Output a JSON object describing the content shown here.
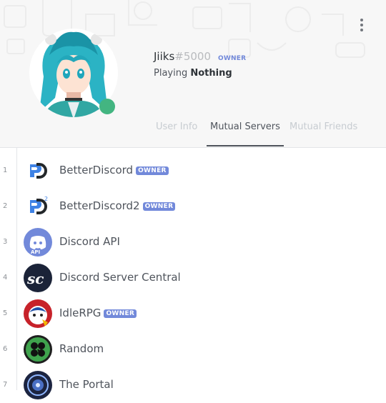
{
  "profile": {
    "username": "Jiiks",
    "discriminator": "#5000",
    "owner_tag": "OWNER",
    "activity_prefix": "Playing",
    "activity_name": "Nothing",
    "status": "online",
    "status_color": "#43b581"
  },
  "tabs": [
    {
      "label": "User Info",
      "active": false
    },
    {
      "label": "Mutual Servers",
      "active": true
    },
    {
      "label": "Mutual Friends",
      "active": false
    }
  ],
  "servers": [
    {
      "num": "1",
      "name": "BetterDiscord",
      "owner": true,
      "badge": "OWNER",
      "icon": "betterdiscord-icon"
    },
    {
      "num": "2",
      "name": "BetterDiscord2",
      "owner": true,
      "badge": "OWNER",
      "icon": "betterdiscord2-icon"
    },
    {
      "num": "3",
      "name": "Discord API",
      "owner": false,
      "badge": "",
      "icon": "discord-api-icon"
    },
    {
      "num": "4",
      "name": "Discord Server Central",
      "owner": false,
      "badge": "",
      "icon": "server-central-icon"
    },
    {
      "num": "5",
      "name": "IdleRPG",
      "owner": true,
      "badge": "OWNER",
      "icon": "idlerpg-icon"
    },
    {
      "num": "6",
      "name": "Random",
      "owner": false,
      "badge": "",
      "icon": "clover-icon"
    },
    {
      "num": "7",
      "name": "The Portal",
      "owner": false,
      "badge": "",
      "icon": "portal-icon"
    }
  ],
  "colors": {
    "accent": "#7289da",
    "online": "#43b581",
    "header_bg": "#f7f7f7"
  }
}
